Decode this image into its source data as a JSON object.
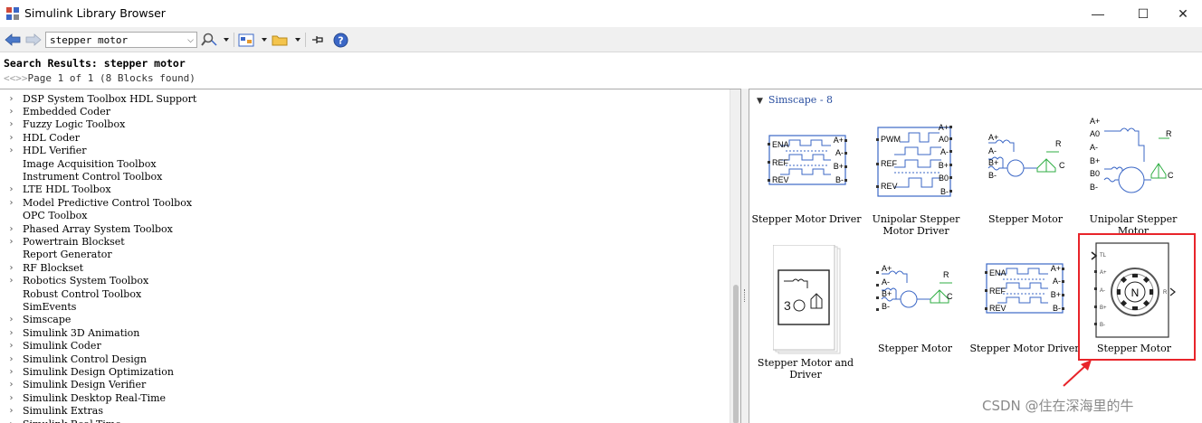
{
  "window": {
    "title": "Simulink Library Browser",
    "minimize_glyph": "—",
    "maximize_glyph": "☐",
    "close_glyph": "✕"
  },
  "toolbar": {
    "search_value": "stepper motor",
    "icons": [
      "back-arrow-icon",
      "forward-arrow-icon",
      "search-options-icon",
      "new-model-icon",
      "open-model-icon",
      "pin-icon",
      "help-icon"
    ]
  },
  "results": {
    "heading": "Search Results: stepper motor",
    "pager_arrows": "<<>>",
    "pager_text": "Page 1 of 1 (8 Blocks found)"
  },
  "tree": {
    "items": [
      {
        "label": "DSP System Toolbox HDL Support",
        "expandable": true
      },
      {
        "label": "Embedded Coder",
        "expandable": true
      },
      {
        "label": "Fuzzy Logic Toolbox",
        "expandable": true
      },
      {
        "label": "HDL Coder",
        "expandable": true
      },
      {
        "label": "HDL Verifier",
        "expandable": true
      },
      {
        "label": "Image Acquisition Toolbox",
        "expandable": false
      },
      {
        "label": "Instrument Control Toolbox",
        "expandable": false
      },
      {
        "label": "LTE HDL Toolbox",
        "expandable": true
      },
      {
        "label": "Model Predictive Control Toolbox",
        "expandable": true
      },
      {
        "label": "OPC Toolbox",
        "expandable": false
      },
      {
        "label": "Phased Array System Toolbox",
        "expandable": true
      },
      {
        "label": "Powertrain Blockset",
        "expandable": true
      },
      {
        "label": "Report Generator",
        "expandable": false
      },
      {
        "label": "RF Blockset",
        "expandable": true
      },
      {
        "label": "Robotics System Toolbox",
        "expandable": true
      },
      {
        "label": "Robust Control Toolbox",
        "expandable": false
      },
      {
        "label": "SimEvents",
        "expandable": false
      },
      {
        "label": "Simscape",
        "expandable": true
      },
      {
        "label": "Simulink 3D Animation",
        "expandable": true
      },
      {
        "label": "Simulink Coder",
        "expandable": true
      },
      {
        "label": "Simulink Control Design",
        "expandable": true
      },
      {
        "label": "Simulink Design Optimization",
        "expandable": true
      },
      {
        "label": "Simulink Design Verifier",
        "expandable": true
      },
      {
        "label": "Simulink Desktop Real-Time",
        "expandable": true
      },
      {
        "label": "Simulink Extras",
        "expandable": true
      },
      {
        "label": "Simulink Real-Time",
        "expandable": true
      }
    ]
  },
  "blocks_group": {
    "title": "Simscape - 8"
  },
  "blocks": {
    "b1": {
      "line1": "Stepper Motor Driver",
      "line2": "",
      "ports_left": [
        "ENA",
        "REF",
        "REV"
      ],
      "ports_right": [
        "A+",
        "A-",
        "B+",
        "B-"
      ]
    },
    "b2": {
      "line1": "Unipolar Stepper",
      "line2": "Motor Driver",
      "ports_left": [
        "PWM",
        "REF",
        "REV"
      ],
      "ports_right": [
        "A+",
        "A0",
        "A-",
        "B+",
        "B0",
        "B-"
      ]
    },
    "b3": {
      "line1": "Stepper Motor",
      "line2": "",
      "ports_left": [
        "A+",
        "A-",
        "B+",
        "B-"
      ],
      "ports_right": [
        "R",
        "C"
      ]
    },
    "b4": {
      "line1": "Unipolar Stepper",
      "line2": "Motor",
      "ports_left": [
        "A+",
        "A0",
        "A-",
        "B+",
        "B0",
        "B-"
      ],
      "ports_right": [
        "R",
        "C"
      ]
    },
    "b5": {
      "line1": "Stepper Motor and",
      "line2": "Driver"
    },
    "b6": {
      "line1": "Stepper Motor",
      "line2": "",
      "ports_left": [
        "A+",
        "A-",
        "B+",
        "B-"
      ],
      "ports_right": [
        "R",
        "C"
      ]
    },
    "b7": {
      "line1": "Stepper Motor Driver",
      "line2": "",
      "ports_left": [
        "ENA",
        "REF",
        "REV"
      ],
      "ports_right": [
        "A+",
        "A-",
        "B+",
        "B-"
      ]
    },
    "b8": {
      "line1": "Stepper Motor",
      "line2": "",
      "ports_left": [
        "TL",
        "A+",
        "A-",
        "B+",
        "B-"
      ],
      "ports_right": [
        "R"
      ],
      "rotor_letter": "N"
    }
  },
  "watermark": "CSDN @住在深海里的牛",
  "colors": {
    "block_blue": "#3b67c6",
    "block_green": "#2fae43",
    "highlight_red": "#e8242a",
    "group_title": "#2a4fa0"
  }
}
